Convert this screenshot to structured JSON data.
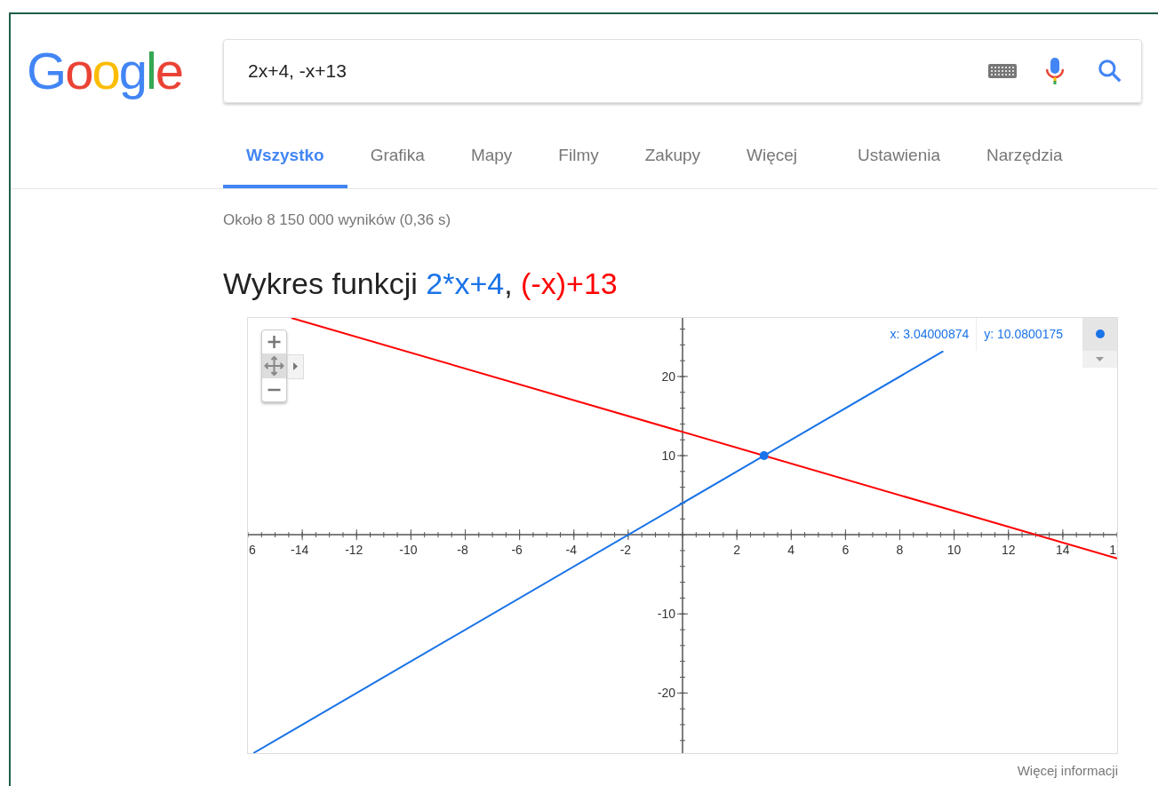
{
  "logo": {
    "letters": [
      {
        "char": "G",
        "color": "#4285f4"
      },
      {
        "char": "o",
        "color": "#ea4335"
      },
      {
        "char": "o",
        "color": "#fbbc05"
      },
      {
        "char": "g",
        "color": "#4285f4"
      },
      {
        "char": "l",
        "color": "#34a853"
      },
      {
        "char": "e",
        "color": "#ea4335"
      }
    ]
  },
  "search": {
    "value": "2x+4, -x+13"
  },
  "tabs": [
    {
      "label": "Wszystko",
      "selected": true
    },
    {
      "label": "Grafika",
      "selected": false
    },
    {
      "label": "Mapy",
      "selected": false
    },
    {
      "label": "Filmy",
      "selected": false
    },
    {
      "label": "Zakupy",
      "selected": false
    },
    {
      "label": "Więcej",
      "selected": false
    }
  ],
  "tools": [
    "Ustawienia",
    "Narzędzia"
  ],
  "result_stats": "Około 8 150 000 wyników (0,36 s)",
  "graph": {
    "title_prefix": "Wykres funkcji",
    "title_separator": ",",
    "readout": {
      "x": "x: 3.04000874",
      "y": "y: 10.0800175",
      "color": "#1a73e8"
    },
    "edge_tick_labels": [
      "6",
      "1"
    ],
    "chart_data": {
      "type": "line",
      "x": [
        -15.8,
        -14.4,
        9.6,
        16
      ],
      "series": [
        {
          "name": "2*x+4",
          "color": "#1a73e8",
          "values": [
            -27.6,
            -24.8,
            23.2,
            null
          ]
        },
        {
          "name": "(-x)+13",
          "color": "#ff0000",
          "values": [
            null,
            27.4,
            3.4,
            -3
          ]
        }
      ],
      "xlim": [
        -16,
        16
      ],
      "ylim": [
        -27.6,
        27.4
      ],
      "xticks": [
        -14,
        -12,
        -10,
        -8,
        -6,
        -4,
        -2,
        2,
        4,
        6,
        8,
        10,
        12,
        14
      ],
      "yticks": [
        -20,
        -10,
        10,
        20
      ]
    },
    "more_link": "Więcej informacji"
  }
}
